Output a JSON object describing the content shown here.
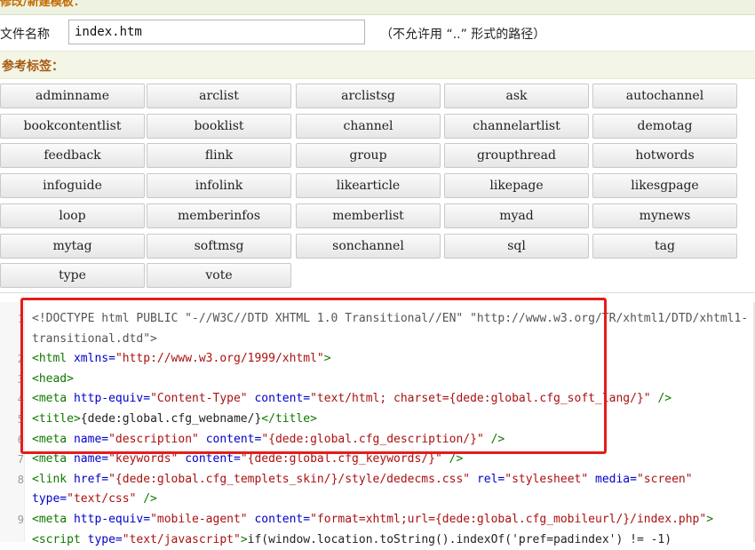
{
  "header": {
    "title": "修改/新建模板："
  },
  "file": {
    "label": "文件名称",
    "value": "index.htm",
    "hint": "（不允许用 “..” 形式的路径）"
  },
  "reference": {
    "label": "参考标签："
  },
  "tags": [
    "adminname",
    "arclist",
    "arclistsg",
    "ask",
    "autochannel",
    "bookcontentlist",
    "booklist",
    "channel",
    "channelartlist",
    "demotag",
    "feedback",
    "flink",
    "group",
    "groupthread",
    "hotwords",
    "infoguide",
    "infolink",
    "likearticle",
    "likepage",
    "likesgpage",
    "loop",
    "memberinfos",
    "memberlist",
    "myad",
    "mynews",
    "mytag",
    "softmsg",
    "sonchannel",
    "sql",
    "tag",
    "type",
    "vote"
  ],
  "editor": {
    "line_numbers": [
      "1",
      "",
      "2",
      "3",
      "4",
      "5",
      "6",
      "7",
      "8",
      "",
      "9",
      ""
    ],
    "lines": [
      [
        [
          "cm",
          "<!DOCTYPE html PUBLIC \"-//W3C//DTD XHTML 1.0 Transitional//EN\" \"http://www.w3.org/TR/xhtml1/DTD/xhtml1-"
        ]
      ],
      [
        [
          "cm",
          "transitional.dtd\">"
        ]
      ],
      [
        [
          "tg",
          "<html "
        ],
        [
          "at",
          "xmlns="
        ],
        [
          "st",
          "\"http://www.w3.org/1999/xhtml\""
        ],
        [
          "tg",
          ">"
        ]
      ],
      [
        [
          "tg",
          "<head>"
        ]
      ],
      [
        [
          "tg",
          "<meta "
        ],
        [
          "at",
          "http-equiv="
        ],
        [
          "st",
          "\"Content-Type\" "
        ],
        [
          "at",
          "content="
        ],
        [
          "st",
          "\"text/html; charset={dede:global.cfg_soft_lang/}\" "
        ],
        [
          "tg",
          "/>"
        ]
      ],
      [
        [
          "tg",
          "<title>"
        ],
        [
          "tx",
          "{dede:global.cfg_webname/}"
        ],
        [
          "tg",
          "</title>"
        ]
      ],
      [
        [
          "tg",
          "<meta "
        ],
        [
          "at",
          "name="
        ],
        [
          "st",
          "\"description\" "
        ],
        [
          "at",
          "content="
        ],
        [
          "st",
          "\"{dede:global.cfg_description/}\" "
        ],
        [
          "tg",
          "/>"
        ]
      ],
      [
        [
          "tg",
          "<meta "
        ],
        [
          "at",
          "name="
        ],
        [
          "st",
          "\"keywords\" "
        ],
        [
          "at",
          "content="
        ],
        [
          "st",
          "\"{dede:global.cfg_keywords/}\" "
        ],
        [
          "tg",
          "/>"
        ]
      ],
      [
        [
          "tg",
          "<link "
        ],
        [
          "at",
          "href="
        ],
        [
          "st",
          "\"{dede:global.cfg_templets_skin/}/style/dedecms.css\" "
        ],
        [
          "at",
          "rel="
        ],
        [
          "st",
          "\"stylesheet\" "
        ],
        [
          "at",
          "media="
        ],
        [
          "st",
          "\"screen\""
        ]
      ],
      [
        [
          "at",
          "type="
        ],
        [
          "st",
          "\"text/css\" "
        ],
        [
          "tg",
          "/>"
        ]
      ],
      [
        [
          "tg",
          "<meta "
        ],
        [
          "at",
          "http-equiv="
        ],
        [
          "st",
          "\"mobile-agent\" "
        ],
        [
          "at",
          "content="
        ],
        [
          "st",
          "\"format=xhtml;url={dede:global.cfg_mobileurl/}/index.php\""
        ],
        [
          "tg",
          ">"
        ]
      ],
      [
        [
          "tg",
          "<script "
        ],
        [
          "at",
          "type="
        ],
        [
          "st",
          "\"text/javascript\""
        ],
        [
          "tg",
          ">"
        ],
        [
          "tx",
          "if(window.location.toString().indexOf('pref=padindex') != -1)"
        ]
      ]
    ]
  }
}
